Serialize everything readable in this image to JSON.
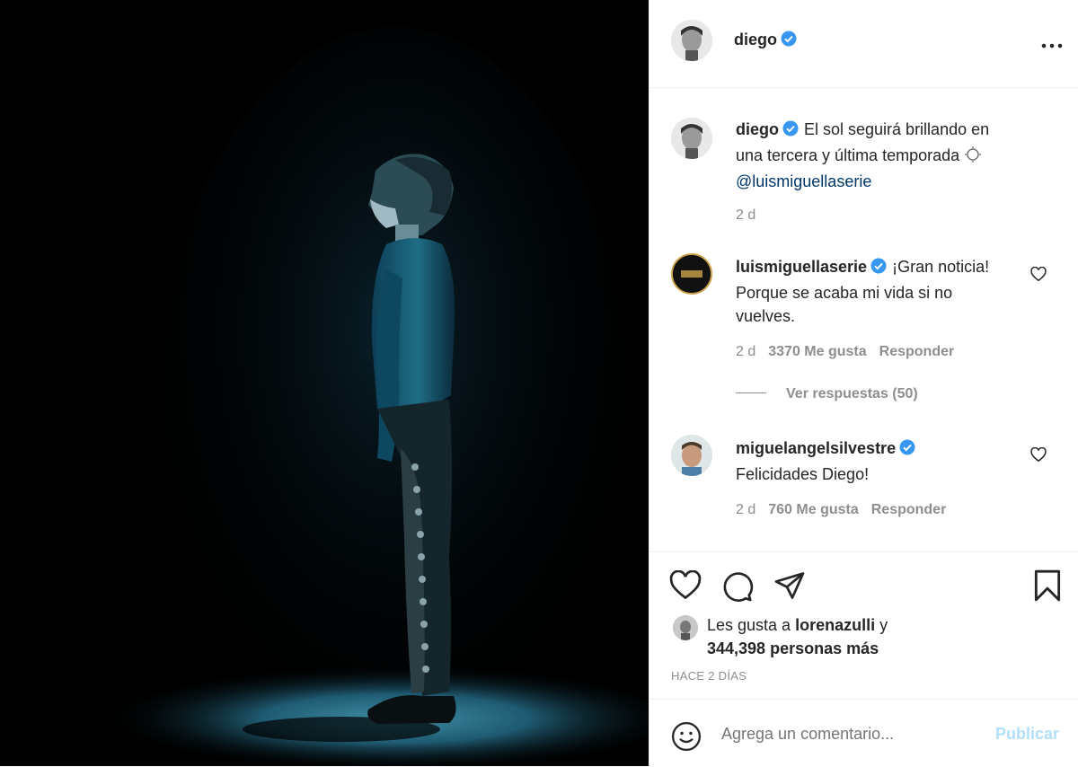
{
  "post": {
    "author": "diego",
    "verified_color": "#3897f0",
    "accent_link_color": "#00376b",
    "caption_line1": "El sol seguirá brillando en",
    "caption_line2": "una tercera y última temporada",
    "caption_mention": "@luismiguellaserie",
    "caption_age": "2 d",
    "photo_description_icon": "man-on-stage-spotlight"
  },
  "header": {
    "username": "diego",
    "more_icon": "more-options-icon"
  },
  "comments": [
    {
      "username": "luismiguellaserie",
      "line1": "¡Gran noticia!",
      "line2": "Porque se acaba mi vida si no",
      "line3": "vuelves.",
      "age": "2 d",
      "likes": "3370 Me gusta",
      "reply": "Responder",
      "view_replies": "Ver respuestas (50)"
    },
    {
      "username": "miguelangelsilvestre",
      "line1": "Felicidades Diego!",
      "age": "2 d",
      "likes": "760 Me gusta",
      "reply": "Responder"
    }
  ],
  "actions": {
    "likes_prefix": "Les gusta a",
    "liked_by": "lorenazulli",
    "likes_join": "y",
    "likes_count": "344,398",
    "likes_suffix": "personas más",
    "date": "HACE 2 DÍAS"
  },
  "composer": {
    "placeholder": "Agrega un comentario...",
    "publish": "Publicar",
    "publish_color": "#b2dffc"
  }
}
